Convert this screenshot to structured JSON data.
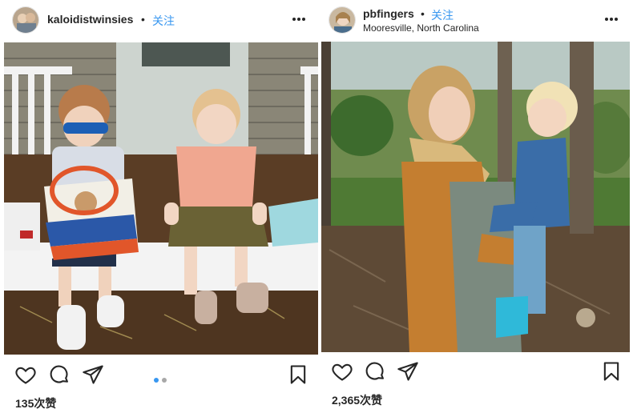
{
  "posts": [
    {
      "username": "kaloidistwinsies",
      "separator": "•",
      "follow_label": "关注",
      "more_icon": "more-horizontal-icon",
      "photo_description_icon": "photo-kids-on-steps",
      "likes": "135次赞",
      "carousel": {
        "count": 2,
        "active": 1,
        "active_color": "#3897f0",
        "inactive_color": "#a8a8a8"
      }
    },
    {
      "username": "pbfingers",
      "separator": "•",
      "follow_label": "关注",
      "location": "Mooresville, North Carolina",
      "more_icon": "more-horizontal-icon",
      "photo_description_icon": "photo-mother-and-toddler",
      "likes": "2,365次赞"
    }
  ],
  "icons": {
    "like": "heart-icon",
    "comment": "comment-bubble-icon",
    "share": "paper-plane-icon",
    "save": "bookmark-icon"
  },
  "colors": {
    "link": "#3897f0",
    "text": "#262626"
  }
}
